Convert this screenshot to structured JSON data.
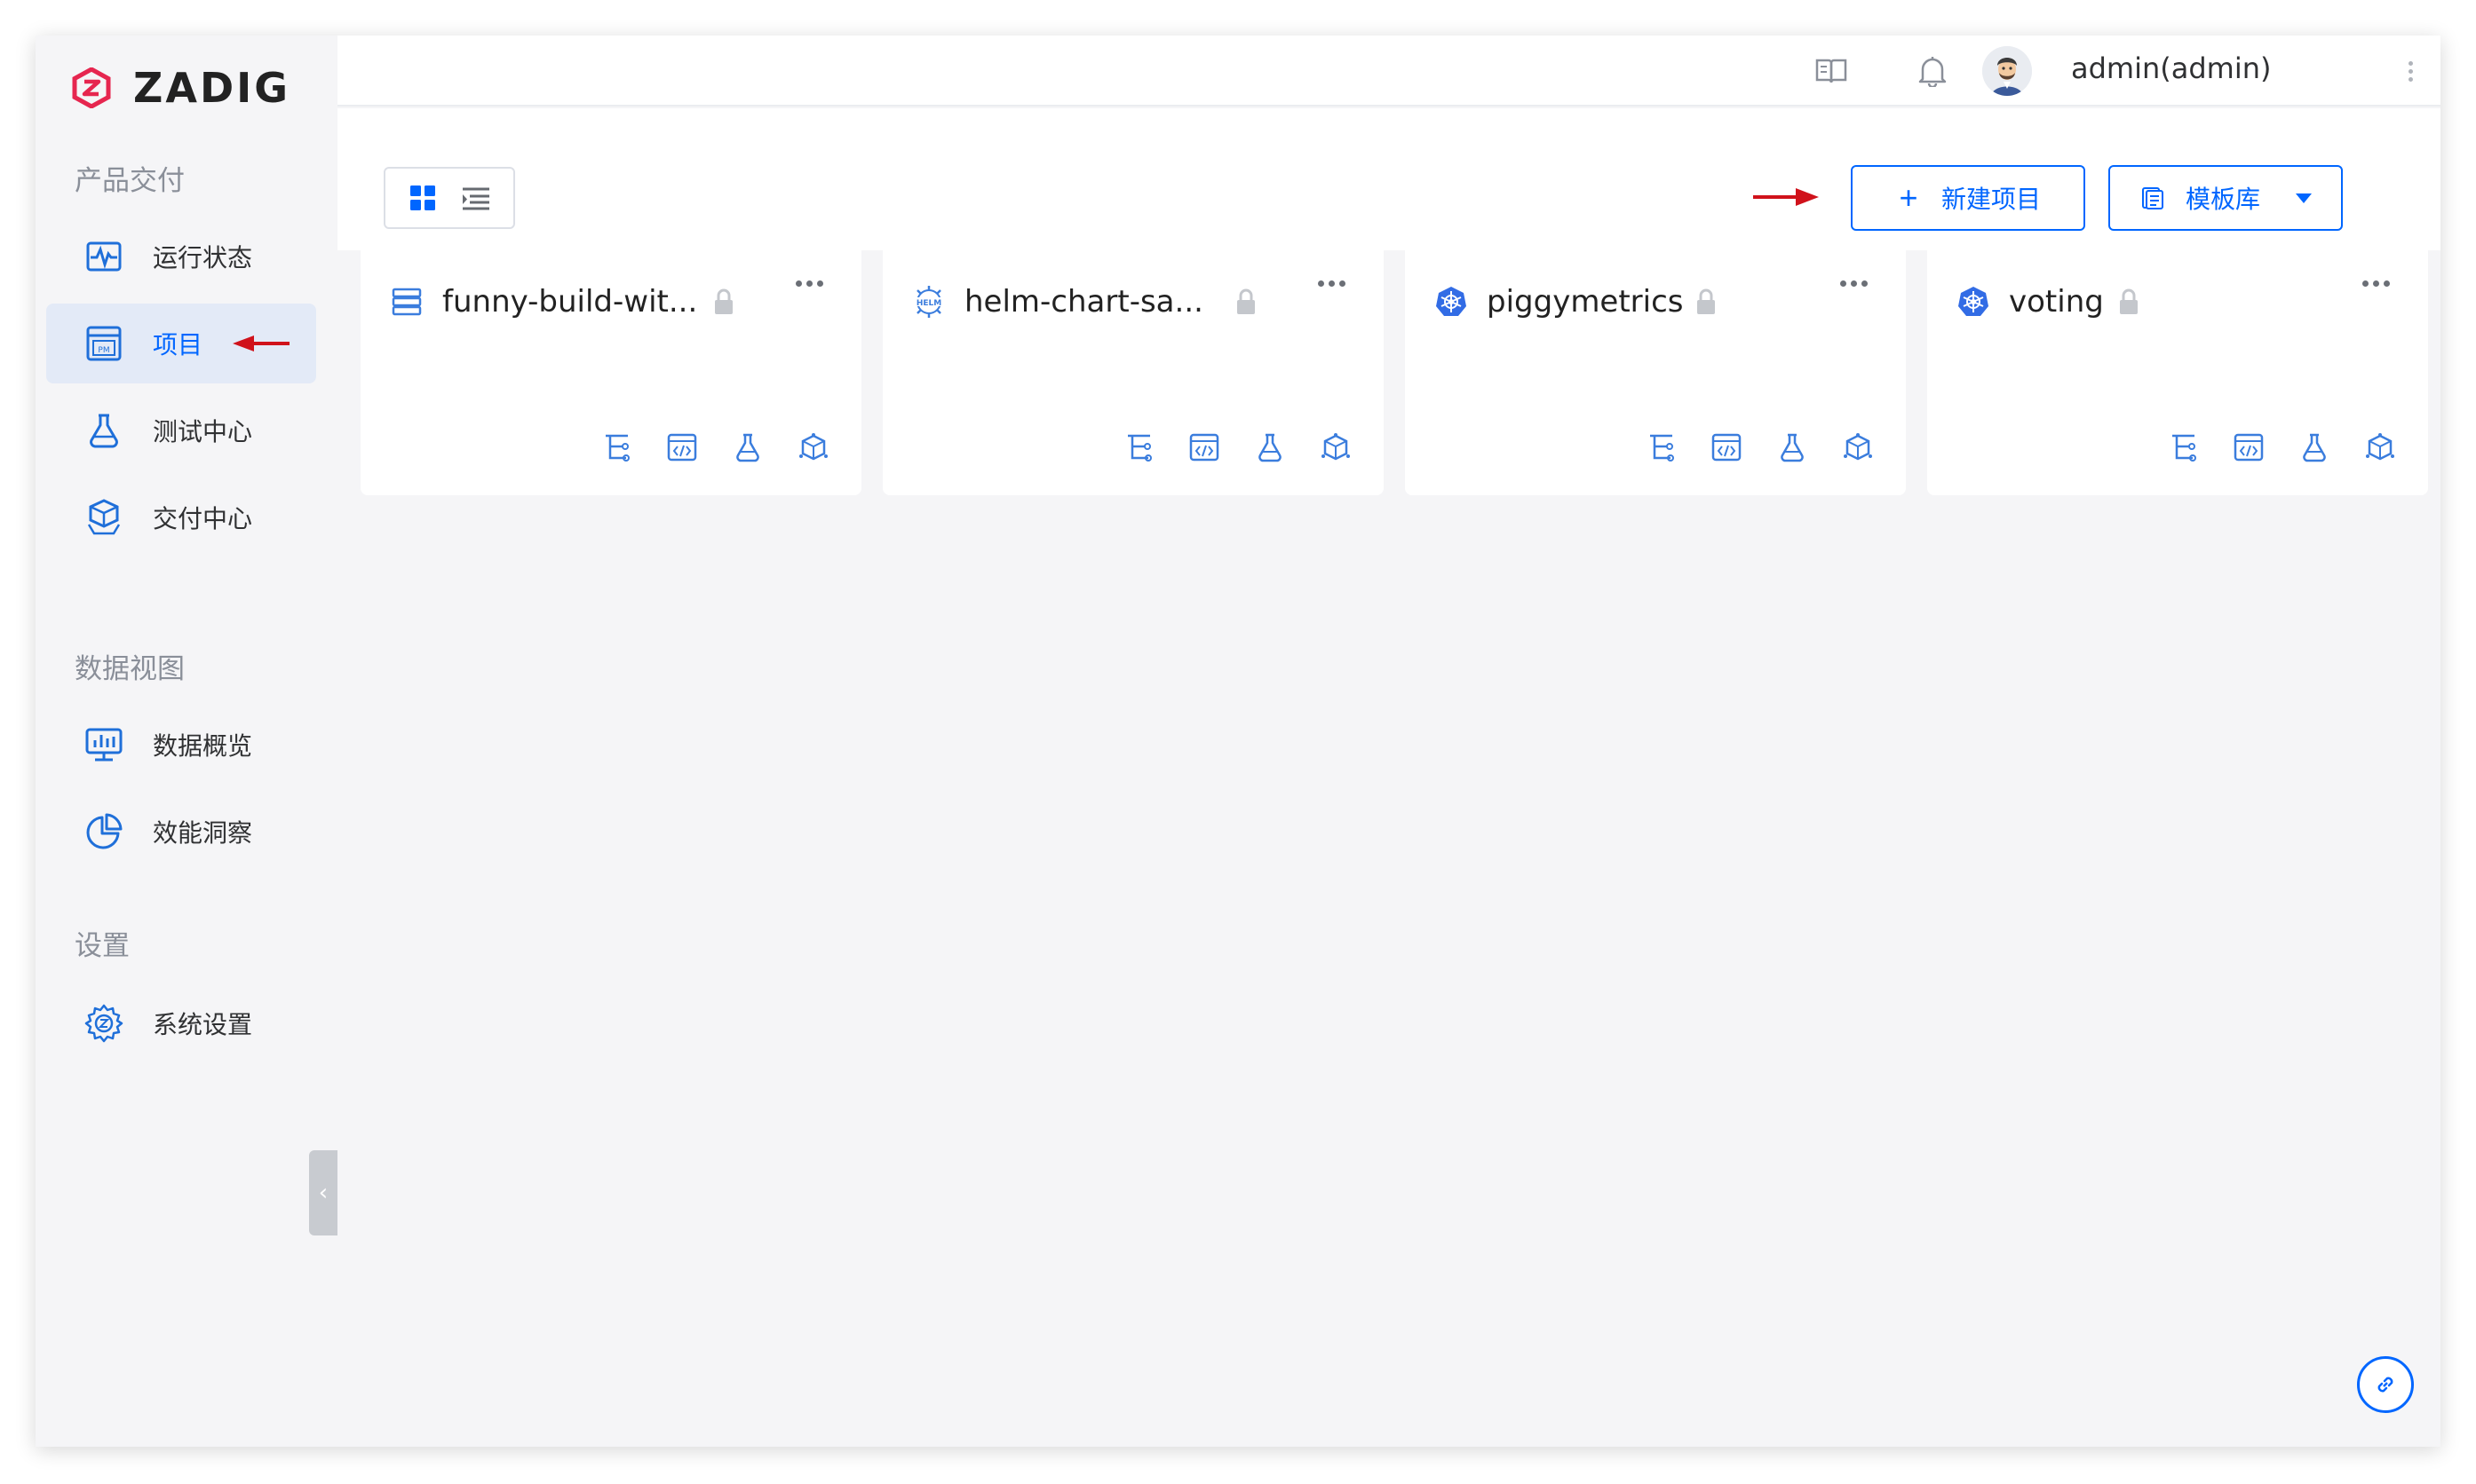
{
  "app": {
    "logo_text": "ZADIG",
    "brand_color": "#e6264f",
    "accent_color": "#0066ff"
  },
  "sidebar": {
    "sections": [
      {
        "title": "产品交付"
      },
      {
        "title": "数据视图"
      },
      {
        "title": "设置"
      }
    ],
    "items": [
      {
        "label": "运行状态",
        "icon": "pulse-monitor-icon",
        "active": false
      },
      {
        "label": "项目",
        "icon": "project-pm-icon",
        "active": true
      },
      {
        "label": "测试中心",
        "icon": "flask-icon",
        "active": false
      },
      {
        "label": "交付中心",
        "icon": "box-hand-icon",
        "active": false
      },
      {
        "label": "数据概览",
        "icon": "bar-chart-monitor-icon",
        "active": false
      },
      {
        "label": "效能洞察",
        "icon": "pie-chart-icon",
        "active": false
      },
      {
        "label": "系统设置",
        "icon": "gear-icon",
        "active": false
      }
    ],
    "collapse_glyph": "‹"
  },
  "header": {
    "icons": [
      "book-icon",
      "bell-icon"
    ],
    "username": "admin(admin)"
  },
  "toolbar": {
    "view_modes": [
      "grid-view-icon",
      "list-view-icon"
    ],
    "new_project_label": "新建项目",
    "new_project_glyph": "+",
    "template_label": "模板库"
  },
  "projects": [
    {
      "name": "funny-build-wit...",
      "type_icon": "server-stack-icon",
      "private": true
    },
    {
      "name": "helm-chart-sa...",
      "type_icon": "helm-icon",
      "private": true
    },
    {
      "name": "piggymetrics",
      "type_icon": "kubernetes-icon",
      "private": true
    },
    {
      "name": "voting",
      "type_icon": "kubernetes-icon",
      "private": true
    }
  ],
  "card_actions": [
    "workflow-icon",
    "code-service-icon",
    "test-flask-icon",
    "environment-cube-icon"
  ]
}
